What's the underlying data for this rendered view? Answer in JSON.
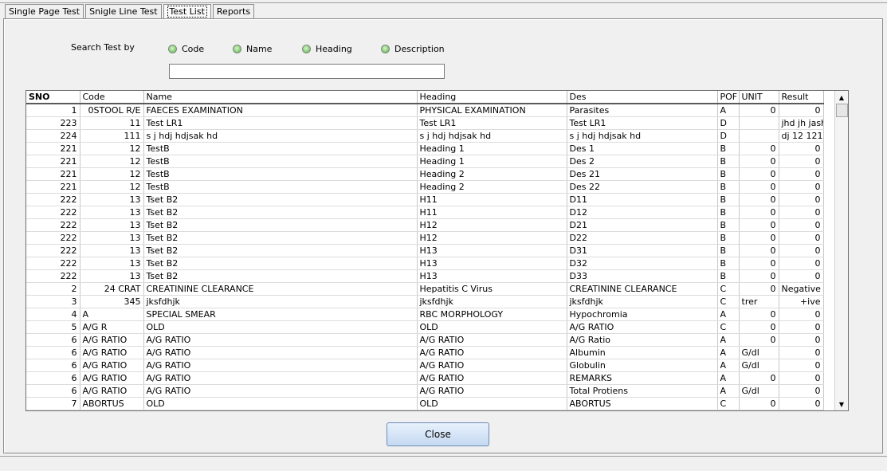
{
  "tabs": [
    {
      "label": "Single Page Test"
    },
    {
      "label": "Snigle Line Test"
    },
    {
      "label": "Test List"
    },
    {
      "label": "Reports"
    }
  ],
  "search": {
    "label": "Search Test by",
    "options": [
      "Code",
      "Name",
      "Heading",
      "Description"
    ],
    "value": ""
  },
  "grid": {
    "columns": [
      "SNO",
      "Code",
      "Name",
      "Heading",
      "Des",
      "POF",
      "UNIT",
      "Result"
    ],
    "rows": [
      [
        "1",
        "0STOOL R/E",
        "FAECES EXAMINATION",
        "PHYSICAL EXAMINATION",
        "Parasites",
        "A",
        "0",
        "0"
      ],
      [
        "223",
        "11",
        "Test LR1",
        "Test LR1",
        "Test LR1",
        "D",
        "",
        "jhd jh jash"
      ],
      [
        "224",
        "111",
        "s j hdj hdjsak hd",
        "s j hdj hdjsak hd",
        "s j hdj hdjsak hd",
        "D",
        "",
        "dj 12  121"
      ],
      [
        "221",
        "12",
        "TestB",
        "Heading 1",
        "Des 1",
        "B",
        "0",
        "0"
      ],
      [
        "221",
        "12",
        "TestB",
        "Heading 1",
        "Des 2",
        "B",
        "0",
        "0"
      ],
      [
        "221",
        "12",
        "TestB",
        "Heading 2",
        "Des 21",
        "B",
        "0",
        "0"
      ],
      [
        "221",
        "12",
        "TestB",
        "Heading 2",
        "Des 22",
        "B",
        "0",
        "0"
      ],
      [
        "222",
        "13",
        "Tset B2",
        "H11",
        "D11",
        "B",
        "0",
        "0"
      ],
      [
        "222",
        "13",
        "Tset B2",
        "H11",
        "D12",
        "B",
        "0",
        "0"
      ],
      [
        "222",
        "13",
        "Tset B2",
        "H12",
        "D21",
        "B",
        "0",
        "0"
      ],
      [
        "222",
        "13",
        "Tset B2",
        "H12",
        "D22",
        "B",
        "0",
        "0"
      ],
      [
        "222",
        "13",
        "Tset B2",
        "H13",
        "D31",
        "B",
        "0",
        "0"
      ],
      [
        "222",
        "13",
        "Tset B2",
        "H13",
        "D32",
        "B",
        "0",
        "0"
      ],
      [
        "222",
        "13",
        "Tset B2",
        "H13",
        "D33",
        "B",
        "0",
        "0"
      ],
      [
        "2",
        "24 CRAT",
        "CREATININE CLEARANCE",
        "Hepatitis C Virus",
        "CREATININE CLEARANCE",
        "C",
        "0",
        "Negative"
      ],
      [
        "3",
        "345",
        "jksfdhjk",
        "jksfdhjk",
        "jksfdhjk",
        "C",
        "trer",
        "+ive"
      ],
      [
        "4",
        "A",
        "SPECIAL SMEAR",
        "RBC MORPHOLOGY",
        "Hypochromia",
        "A",
        "0",
        "0"
      ],
      [
        "5",
        "A/G R",
        "OLD",
        "OLD",
        "A/G RATIO",
        "C",
        "0",
        "0"
      ],
      [
        "6",
        "A/G RATIO",
        "A/G RATIO",
        "A/G RATIO",
        "A/G Ratio",
        "A",
        "0",
        "0"
      ],
      [
        "6",
        "A/G RATIO",
        "A/G RATIO",
        "A/G RATIO",
        "Albumin",
        "A",
        "G/dl",
        "0"
      ],
      [
        "6",
        "A/G RATIO",
        "A/G RATIO",
        "A/G RATIO",
        "Globulin",
        "A",
        "G/dl",
        "0"
      ],
      [
        "6",
        "A/G RATIO",
        "A/G RATIO",
        "A/G RATIO",
        "REMARKS",
        "A",
        "0",
        "0"
      ],
      [
        "6",
        "A/G RATIO",
        "A/G RATIO",
        "A/G RATIO",
        "Total Protiens",
        "A",
        "G/dl",
        "0"
      ],
      [
        "7",
        "ABORTUS",
        "OLD",
        "OLD",
        "ABORTUS",
        "C",
        "0",
        "0"
      ]
    ]
  },
  "close_label": "Close",
  "icons": {
    "scroll_up": "triangle-up",
    "scroll_down": "triangle-down"
  }
}
